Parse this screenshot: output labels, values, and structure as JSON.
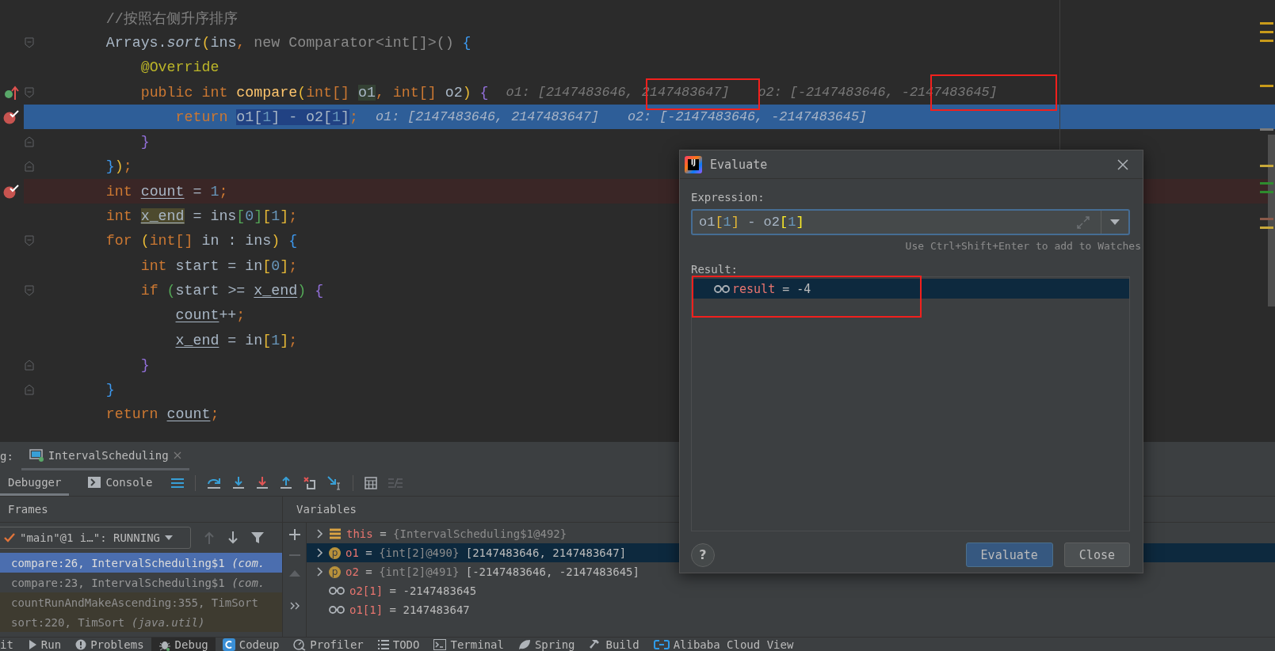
{
  "editor": {
    "lines": [
      {
        "current": false,
        "breakpoint": false,
        "override": false,
        "fold_start": false,
        "fold_end": false,
        "tokens": [
          {
            "text": "        //按照右侧升序排序",
            "kind": "comment"
          }
        ]
      },
      {
        "current": false,
        "breakpoint": false,
        "override": false,
        "fold_start": true,
        "fold_end": false,
        "tokens": [
          {
            "text": "        Arrays.",
            "kind": "plain"
          },
          {
            "text": "sort",
            "kind": "italic"
          },
          {
            "text": "(",
            "kind": "y"
          },
          {
            "text": "ins",
            "kind": "plain"
          },
          {
            "text": ",",
            "kind": "kw"
          },
          {
            "text": " new Comparator<int[]>() ",
            "kind": "gray"
          },
          {
            "text": "{",
            "kind": "bb"
          }
        ]
      },
      {
        "current": false,
        "breakpoint": false,
        "override": false,
        "fold_start": false,
        "fold_end": false,
        "tokens": [
          {
            "text": "            @Override",
            "kind": "ann"
          }
        ]
      },
      {
        "current": false,
        "breakpoint": false,
        "override": true,
        "fold_start": true,
        "fold_end": false,
        "tokens": [
          {
            "text": "            public int ",
            "kind": "kw"
          },
          {
            "text": "compare",
            "kind": "fn"
          },
          {
            "text": "(",
            "kind": "y"
          },
          {
            "text": "int[] ",
            "kind": "kw"
          },
          {
            "text": "o1",
            "kind": "usage"
          },
          {
            "text": ", int[] ",
            "kind": "kw"
          },
          {
            "text": "o2",
            "kind": "plain"
          },
          {
            "text": ")",
            "kind": "y"
          },
          {
            "text": " {",
            "kind": "bp"
          }
        ],
        "hints": [
          "o1: [2147483646, 2147483647]",
          "o2: [-2147483646, -2147483645]"
        ]
      },
      {
        "current": true,
        "breakpoint": true,
        "override": false,
        "fold_start": false,
        "fold_end": false,
        "tokens": [
          {
            "text": "                return ",
            "kind": "kw"
          },
          {
            "text": "o1[",
            "kind": "sel"
          },
          {
            "text": "1",
            "kind": "selnum"
          },
          {
            "text": "] - o2[",
            "kind": "sel"
          },
          {
            "text": "1",
            "kind": "selnum"
          },
          {
            "text": "]",
            "kind": "sel"
          },
          {
            "text": ";",
            "kind": "kw"
          }
        ],
        "hints": [
          "o1: [2147483646, 2147483647]",
          "o2: [-2147483646, -2147483645]"
        ]
      },
      {
        "current": false,
        "breakpoint": false,
        "override": false,
        "fold_start": false,
        "fold_end": true,
        "tokens": [
          {
            "text": "            }",
            "kind": "bp"
          }
        ]
      },
      {
        "current": false,
        "breakpoint": false,
        "override": false,
        "fold_start": false,
        "fold_end": true,
        "tokens": [
          {
            "text": "        }",
            "kind": "bb"
          },
          {
            "text": ")",
            "kind": "y"
          },
          {
            "text": ";",
            "kind": "kw"
          }
        ]
      },
      {
        "current": false,
        "breakpoint": true,
        "override": false,
        "fold_start": false,
        "fold_end": false,
        "tokens": [
          {
            "text": "        int ",
            "kind": "kw"
          },
          {
            "text": "count",
            "kind": "ul"
          },
          {
            "text": " = ",
            "kind": "plain"
          },
          {
            "text": "1",
            "kind": "num"
          },
          {
            "text": ";",
            "kind": "kw"
          }
        ]
      },
      {
        "current": false,
        "breakpoint": false,
        "override": false,
        "fold_start": false,
        "fold_end": false,
        "tokens": [
          {
            "text": "        int ",
            "kind": "kw"
          },
          {
            "text": "x_end",
            "kind": "write"
          },
          {
            "text": " = ins",
            "kind": "plain"
          },
          {
            "text": "[",
            "kind": "bg"
          },
          {
            "text": "0",
            "kind": "num"
          },
          {
            "text": "]",
            "kind": "bg"
          },
          {
            "text": "[",
            "kind": "y"
          },
          {
            "text": "1",
            "kind": "num"
          },
          {
            "text": "]",
            "kind": "y"
          },
          {
            "text": ";",
            "kind": "kw"
          }
        ]
      },
      {
        "current": false,
        "breakpoint": false,
        "override": false,
        "fold_start": true,
        "fold_end": false,
        "tokens": [
          {
            "text": "        for ",
            "kind": "kw"
          },
          {
            "text": "(",
            "kind": "y"
          },
          {
            "text": "int[] ",
            "kind": "kw"
          },
          {
            "text": "in : ins",
            "kind": "plain"
          },
          {
            "text": ")",
            "kind": "y"
          },
          {
            "text": " {",
            "kind": "bb"
          }
        ]
      },
      {
        "current": false,
        "breakpoint": false,
        "override": false,
        "fold_start": false,
        "fold_end": false,
        "tokens": [
          {
            "text": "            int ",
            "kind": "kw"
          },
          {
            "text": "start = in",
            "kind": "plain"
          },
          {
            "text": "[",
            "kind": "y"
          },
          {
            "text": "0",
            "kind": "num"
          },
          {
            "text": "]",
            "kind": "y"
          },
          {
            "text": ";",
            "kind": "kw"
          }
        ]
      },
      {
        "current": false,
        "breakpoint": false,
        "override": false,
        "fold_start": true,
        "fold_end": false,
        "tokens": [
          {
            "text": "            if ",
            "kind": "kw"
          },
          {
            "text": "(",
            "kind": "bg"
          },
          {
            "text": "start >= ",
            "kind": "plain"
          },
          {
            "text": "x_end",
            "kind": "ul"
          },
          {
            "text": ")",
            "kind": "bg"
          },
          {
            "text": " {",
            "kind": "bp"
          }
        ]
      },
      {
        "current": false,
        "breakpoint": false,
        "override": false,
        "fold_start": false,
        "fold_end": false,
        "tokens": [
          {
            "text": "                count",
            "kind": "ul"
          },
          {
            "text": "++",
            "kind": "plain"
          },
          {
            "text": ";",
            "kind": "kw"
          }
        ]
      },
      {
        "current": false,
        "breakpoint": false,
        "override": false,
        "fold_start": false,
        "fold_end": false,
        "tokens": [
          {
            "text": "                x_end",
            "kind": "ul"
          },
          {
            "text": " = in",
            "kind": "plain"
          },
          {
            "text": "[",
            "kind": "y"
          },
          {
            "text": "1",
            "kind": "num"
          },
          {
            "text": "]",
            "kind": "y"
          },
          {
            "text": ";",
            "kind": "kw"
          }
        ]
      },
      {
        "current": false,
        "breakpoint": false,
        "override": false,
        "fold_start": false,
        "fold_end": true,
        "tokens": [
          {
            "text": "            }",
            "kind": "bp"
          }
        ]
      },
      {
        "current": false,
        "breakpoint": false,
        "override": false,
        "fold_start": false,
        "fold_end": true,
        "tokens": [
          {
            "text": "        }",
            "kind": "bb"
          }
        ]
      },
      {
        "current": false,
        "breakpoint": false,
        "override": false,
        "fold_start": false,
        "fold_end": false,
        "tokens": [
          {
            "text": "        return ",
            "kind": "kw"
          },
          {
            "text": "count",
            "kind": "ul"
          },
          {
            "text": ";",
            "kind": "kw"
          }
        ]
      }
    ]
  },
  "evaluate": {
    "logo_text": "IJ",
    "title": "Evaluate",
    "expression_label": "Expression:",
    "expression": [
      {
        "text": "o1",
        "kind": "plain"
      },
      {
        "text": "[",
        "kind": "y"
      },
      {
        "text": "1",
        "kind": "num"
      },
      {
        "text": "]",
        "kind": "y"
      },
      {
        "text": " - o2",
        "kind": "plain"
      },
      {
        "text": "[",
        "kind": "match"
      },
      {
        "text": "1",
        "kind": "num"
      },
      {
        "text": "]",
        "kind": "match"
      }
    ],
    "hint": "Use Ctrl+Shift+Enter to add to Watches",
    "result_label": "Result:",
    "result": {
      "name": "result",
      "equals": "=",
      "value": "-4",
      "selected": true
    },
    "help": "?",
    "buttons": [
      {
        "label": "Evaluate",
        "default": true
      },
      {
        "label": "Close",
        "default": false
      }
    ]
  },
  "debug": {
    "label": "g:",
    "session_tab": "IntervalScheduling",
    "tabs": [
      {
        "label": "Debugger",
        "selected": true
      },
      {
        "label": "Console",
        "selected": false
      }
    ],
    "frames": {
      "title": "Frames",
      "thread": "\"main\"@1 i…\": RUNNING",
      "items": [
        {
          "text": "compare:26, IntervalScheduling$1 *(com.*",
          "selected": true,
          "library": false
        },
        {
          "text": "compare:23, IntervalScheduling$1 *(com.*",
          "selected": false,
          "library": false
        },
        {
          "text": "countRunAndMakeAscending:355, TimSort",
          "selected": false,
          "library": true
        },
        {
          "text": "sort:220, TimSort *(java.util)*",
          "selected": false,
          "library": true
        }
      ]
    },
    "variables": {
      "title": "Variables",
      "rows": [
        {
          "kind": "object",
          "expandable": true,
          "selected": false,
          "name": "this",
          "equals": "=",
          "ref": "{IntervalScheduling$1@492}"
        },
        {
          "kind": "param",
          "badge": "p",
          "expandable": true,
          "selected": true,
          "name": "o1",
          "equals": "=",
          "ref": "{int[2]@490}",
          "value": "[2147483646, 2147483647]"
        },
        {
          "kind": "param",
          "badge": "p",
          "expandable": true,
          "selected": false,
          "name": "o2",
          "equals": "=",
          "ref": "{int[2]@491}",
          "value": "[-2147483646, -2147483645]"
        },
        {
          "kind": "watch",
          "expandable": false,
          "selected": false,
          "name": "o2[1]",
          "equals": "=",
          "value": "-2147483645"
        },
        {
          "kind": "watch",
          "expandable": false,
          "selected": false,
          "name": "o1[1]",
          "equals": "=",
          "value": "2147483647"
        }
      ]
    }
  },
  "tool_strip": [
    {
      "label": "it",
      "selected": false
    },
    {
      "label": "Run",
      "selected": false
    },
    {
      "label": "Problems",
      "selected": false
    },
    {
      "label": "Debug",
      "selected": true
    },
    {
      "label": "Codeup",
      "selected": false
    },
    {
      "label": "Profiler",
      "selected": false
    },
    {
      "label": "TODO",
      "selected": false
    },
    {
      "label": "Terminal",
      "selected": false
    },
    {
      "label": "Spring",
      "selected": false
    },
    {
      "label": "Build",
      "selected": false
    },
    {
      "label": "Alibaba Cloud View",
      "selected": false
    }
  ]
}
